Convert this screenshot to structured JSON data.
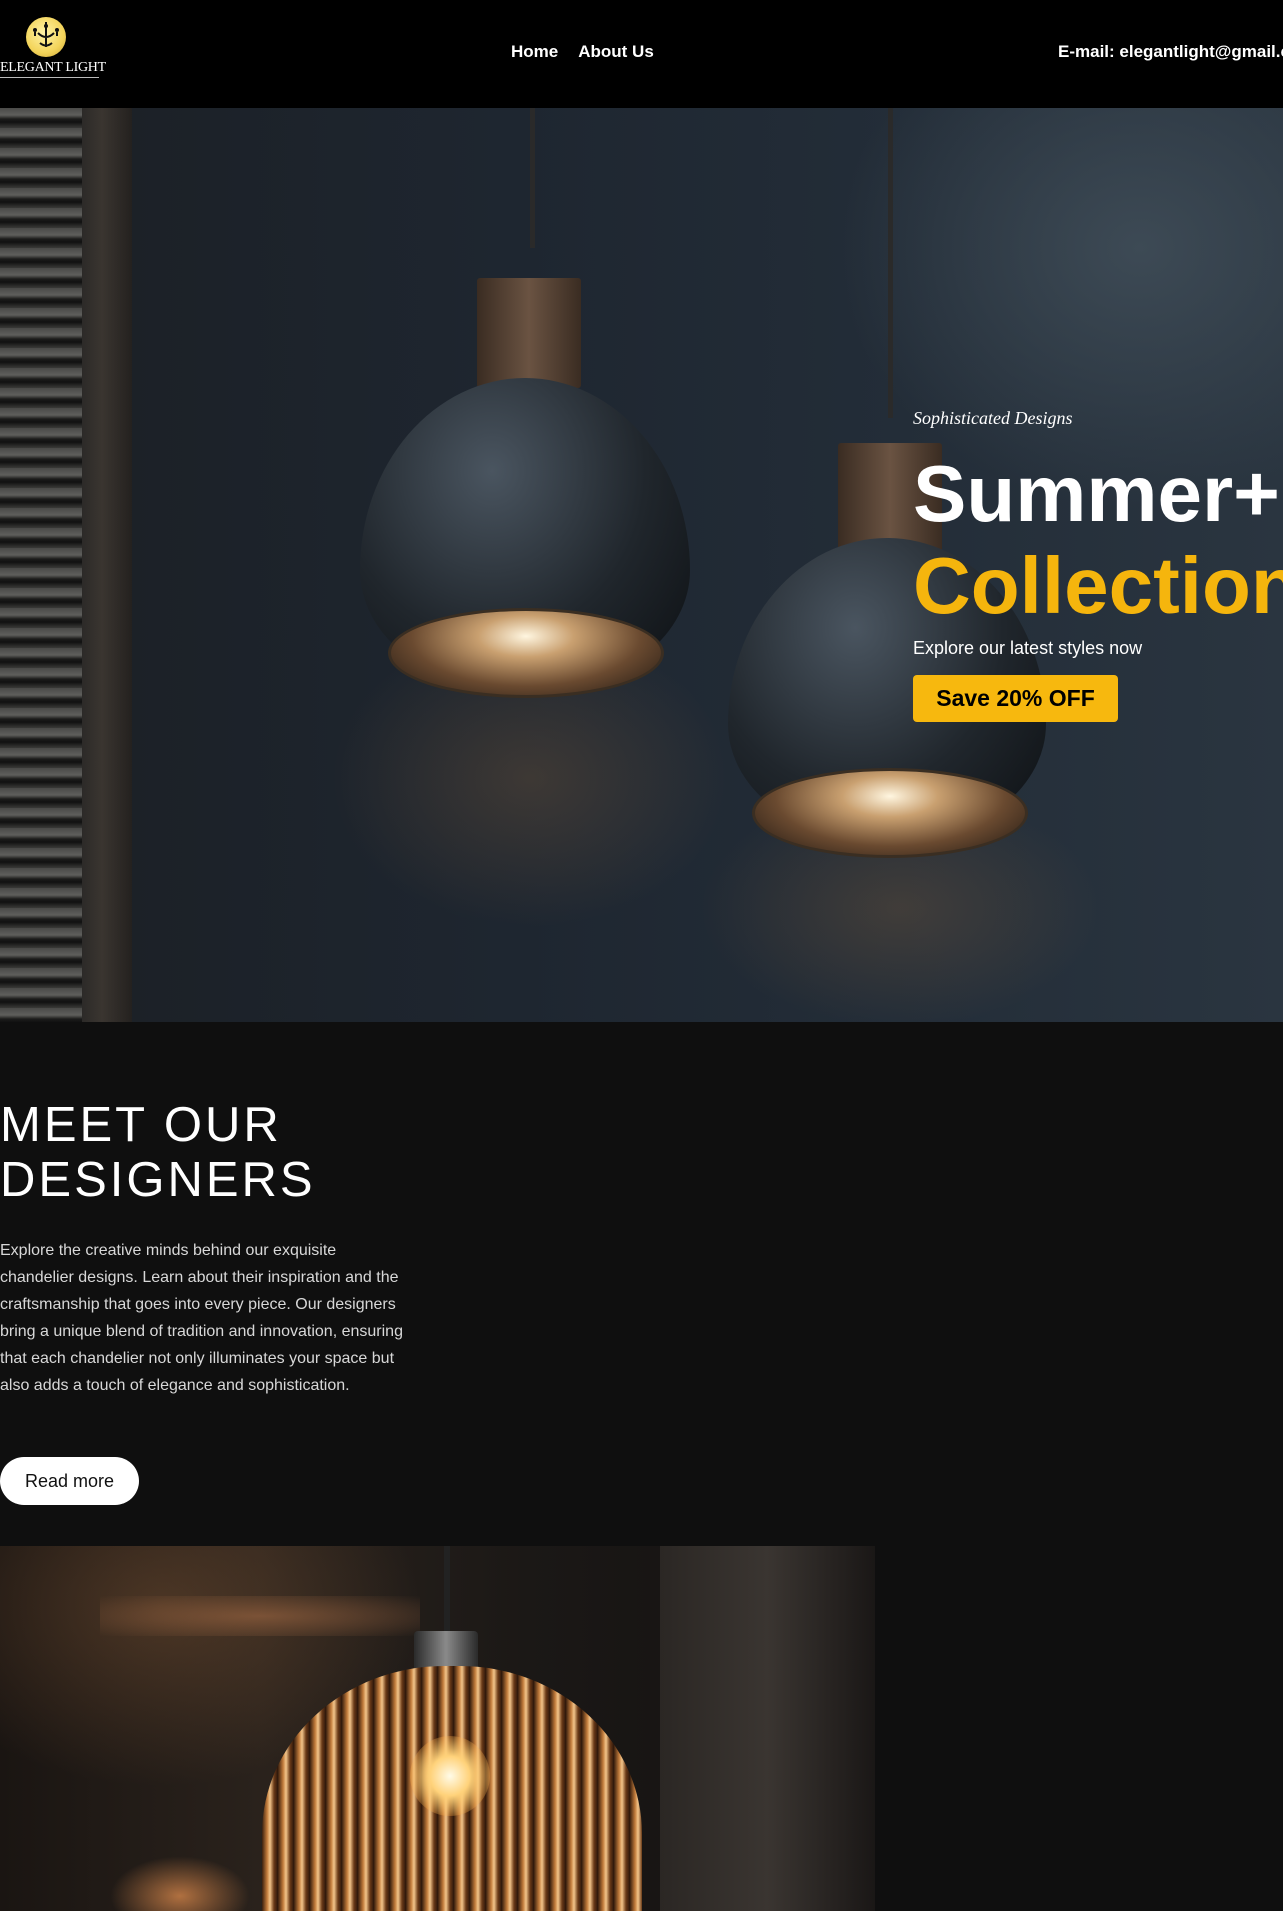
{
  "header": {
    "logo_text": "ELEGANT LIGHT",
    "nav": [
      {
        "label": "Home"
      },
      {
        "label": "About Us"
      }
    ],
    "email": "E-mail: elegantlight@gmail.com"
  },
  "hero": {
    "tagline": "Sophisticated Designs",
    "headline_line1": "Summer+",
    "headline_line2": "Collection",
    "subtitle": "Explore our latest styles now",
    "cta_label": "Save 20% OFF"
  },
  "designers": {
    "title_line1": "MEET OUR",
    "title_line2": "DESIGNERS",
    "body": "Explore the creative minds behind our exquisite chandelier designs. Learn about their inspiration and the craftsmanship that goes into every piece. Our designers bring a unique blend of tradition and innovation, ensuring that each chandelier not only illuminates your space but also adds a touch of elegance and sophistication.",
    "button_label": "Read more"
  },
  "colors": {
    "accent": "#f5b50d",
    "background": "#0f0f0f",
    "header_bg": "#000000"
  }
}
